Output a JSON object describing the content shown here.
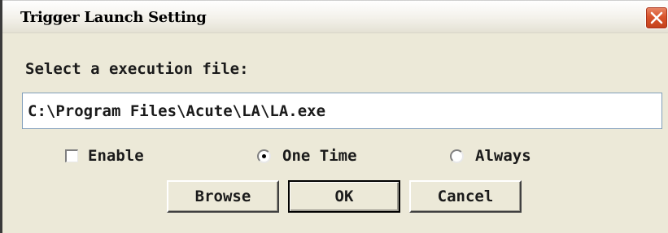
{
  "window": {
    "title": "Trigger Launch Setting",
    "close_icon": "close-icon"
  },
  "form": {
    "select_label": "Select a execution file:",
    "file_path": "C:\\Program Files\\Acute\\LA\\LA.exe"
  },
  "options": {
    "enable_label": "Enable",
    "enable_checked": false,
    "one_time_label": "One Time",
    "always_label": "Always",
    "selected": "One Time"
  },
  "buttons": {
    "browse_label": "Browse",
    "ok_label": "OK",
    "cancel_label": "Cancel"
  },
  "colors": {
    "dialog_bg": "#ece9d8",
    "close_button": "#d9542c"
  }
}
